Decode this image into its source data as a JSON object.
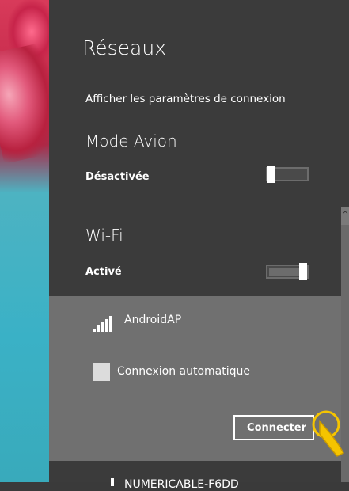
{
  "panel": {
    "title": "Réseaux",
    "settings_link": "Afficher les paramètres de connexion"
  },
  "airplane_mode": {
    "title": "Mode Avion",
    "state_label": "Désactivée",
    "on": false
  },
  "wifi": {
    "title": "Wi-Fi",
    "state_label": "Activé",
    "on": true
  },
  "networks": [
    {
      "name": "AndroidAP",
      "signal_bars": 5,
      "auto_connect_label": "Connexion automatique",
      "auto_connect": false,
      "connect_label": "Connecter"
    },
    {
      "name": "NUMERICABLE-F6DD"
    }
  ],
  "icons": {
    "signal": "wifi-signal-icon",
    "cursor": "touch-cursor-icon",
    "scroll_up": "chevron-up-icon"
  },
  "colors": {
    "panel_bg": "#3b3b3b",
    "selected_item_bg": "#707070",
    "accent_cursor": "#f5c400"
  }
}
